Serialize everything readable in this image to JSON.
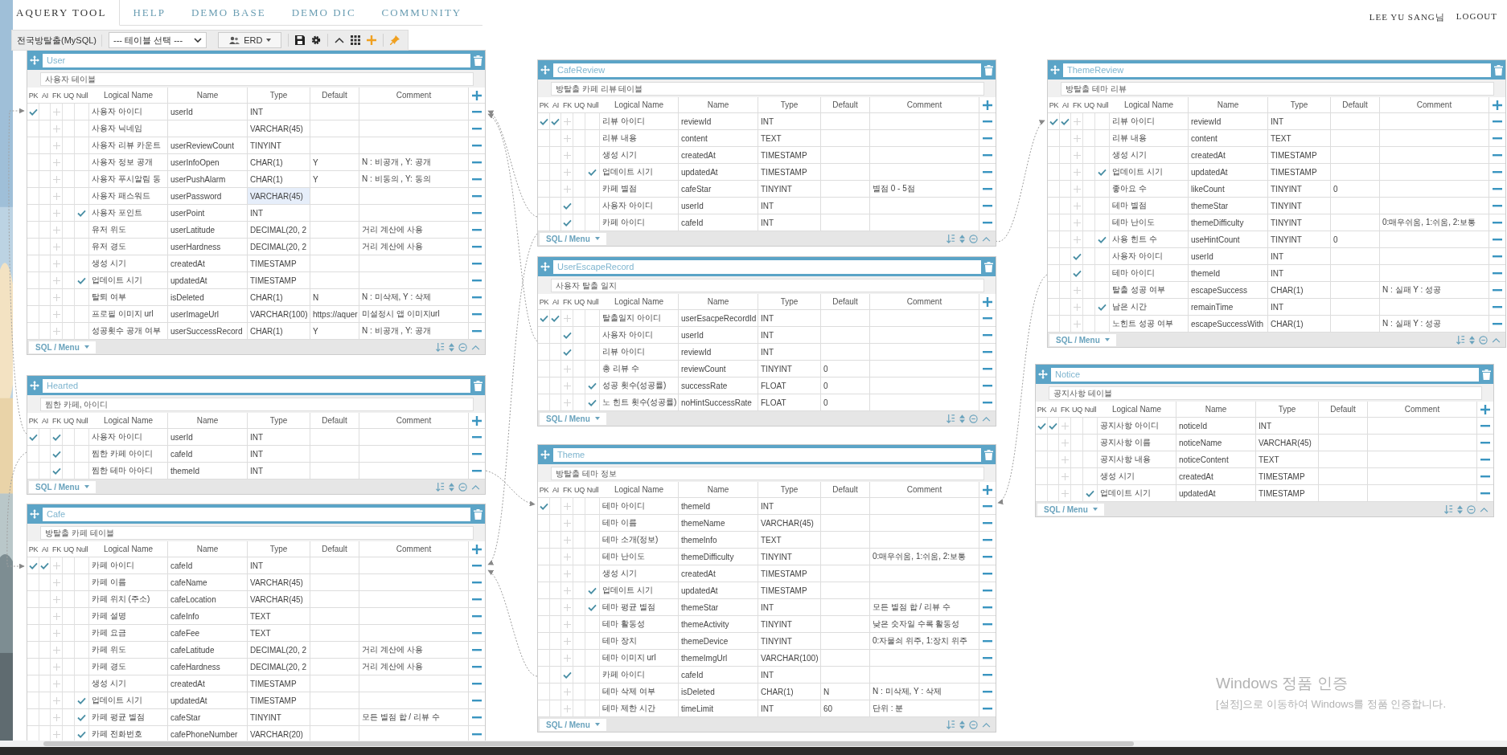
{
  "nav": {
    "tabs": [
      {
        "label": "AQUERY TOOL",
        "selected": true
      },
      {
        "label": "HELP",
        "selected": false
      },
      {
        "label": "DEMO BASE",
        "selected": false
      },
      {
        "label": "DEMO DIC",
        "selected": false
      },
      {
        "label": "COMMUNITY",
        "selected": false
      }
    ],
    "user": "LEE YU SANG님",
    "logout": "LOGOUT"
  },
  "toolbar": {
    "db_label": "전국방탈출(MySQL)",
    "table_select": "--- 테이블 선택 ---",
    "erd_button": "ERD"
  },
  "tables": [
    {
      "name": "User",
      "comment": "사용자 테이블",
      "columns": [
        "PK",
        "AI",
        "FK",
        "UQ",
        "Null",
        "Logical Name",
        "Name",
        "Type",
        "Default",
        "Comment"
      ],
      "menu_label": "SQL / Menu",
      "fields": [
        {
          "pk": true,
          "ai": false,
          "fk": false,
          "nul": false,
          "logical": "사용자 아이디",
          "name": "userId",
          "type": "INT"
        },
        {
          "pk": false,
          "ai": false,
          "fk": false,
          "nul": false,
          "logical": "사용자 닉네임",
          "type": "VARCHAR(45)"
        },
        {
          "pk": false,
          "ai": false,
          "fk": false,
          "nul": false,
          "logical": "사용자 리뷰 카운트",
          "name": "userReviewCount",
          "type": "TINYINT"
        },
        {
          "pk": false,
          "ai": false,
          "fk": false,
          "nul": false,
          "logical": "사용자 정보 공개",
          "name": "userInfoOpen",
          "type": "CHAR(1)",
          "default": "Y",
          "comment": "N : 비공개 , Y: 공개"
        },
        {
          "pk": false,
          "ai": false,
          "fk": false,
          "nul": false,
          "logical": "사용자 푸시알림 동",
          "name": "userPushAlarm",
          "type": "CHAR(1)",
          "default": "Y",
          "comment": "N : 비동의 , Y: 동의"
        },
        {
          "pk": false,
          "ai": false,
          "fk": false,
          "nul": false,
          "logical": "사용자 패스워드",
          "name": "userPassword",
          "type": "VARCHAR(45)",
          "focus": true
        },
        {
          "pk": false,
          "ai": false,
          "fk": false,
          "nul": true,
          "logical": "사용자 포인트",
          "name": "userPoint",
          "type": "INT"
        },
        {
          "pk": false,
          "ai": false,
          "fk": false,
          "nul": false,
          "logical": "유저 위도",
          "name": "userLatitude",
          "type": "DECIMAL(20, 2",
          "comment": "거리 계산에 사용"
        },
        {
          "pk": false,
          "ai": false,
          "fk": false,
          "nul": false,
          "logical": "유저 경도",
          "name": "userHardness",
          "type": "DECIMAL(20, 2",
          "comment": "거리 계산에 사용"
        },
        {
          "pk": false,
          "ai": false,
          "fk": false,
          "nul": false,
          "logical": "생성 시기",
          "name": "createdAt",
          "type": "TIMESTAMP"
        },
        {
          "pk": false,
          "ai": false,
          "fk": false,
          "nul": true,
          "logical": "업데이트 시기",
          "name": "updatedAt",
          "type": "TIMESTAMP"
        },
        {
          "pk": false,
          "ai": false,
          "fk": false,
          "nul": false,
          "logical": "탈퇴 여부",
          "name": "isDeleted",
          "type": "CHAR(1)",
          "default": "N",
          "comment": "N : 미삭제, Y : 삭제"
        },
        {
          "pk": false,
          "ai": false,
          "fk": false,
          "nul": false,
          "logical": "프로필 이미지 url",
          "name": "userImageUrl",
          "type": "VARCHAR(100)",
          "default": "https://aquer",
          "comment": "미설정시 앱 이미지url"
        },
        {
          "pk": false,
          "ai": false,
          "fk": false,
          "nul": false,
          "logical": "성공횟수 공개 여부",
          "name": "userSuccessRecord",
          "type": "CHAR(1)",
          "default": "Y",
          "comment": "N : 비공개 , Y: 공개"
        }
      ]
    },
    {
      "name": "Hearted",
      "comment": "찜한 카페, 아이디",
      "columns": [
        "PK",
        "AI",
        "FK",
        "UQ",
        "Null",
        "Logical Name",
        "Name",
        "Type",
        "Default",
        "Comment"
      ],
      "menu_label": "SQL / Menu",
      "fields": [
        {
          "pk": true,
          "ai": false,
          "fk": true,
          "nul": false,
          "logical": "사용자 아이디",
          "name": "userId",
          "type": "INT"
        },
        {
          "pk": false,
          "ai": false,
          "fk": true,
          "nul": false,
          "logical": "찜한 카페 아이디",
          "name": "cafeId",
          "type": "INT"
        },
        {
          "pk": false,
          "ai": false,
          "fk": true,
          "nul": false,
          "logical": "찜한 테마 아아디",
          "name": "themeId",
          "type": "INT"
        }
      ]
    },
    {
      "name": "Cafe",
      "comment": "방탈출 카페 테이블",
      "columns": [
        "PK",
        "AI",
        "FK",
        "UQ",
        "Null",
        "Logical Name",
        "Name",
        "Type",
        "Default",
        "Comment"
      ],
      "fields": [
        {
          "pk": true,
          "ai": true,
          "fk": false,
          "nul": false,
          "logical": "카페 아이디",
          "name": "cafeId",
          "type": "INT"
        },
        {
          "pk": false,
          "ai": false,
          "fk": false,
          "nul": false,
          "logical": "카페 이름",
          "name": "cafeName",
          "type": "VARCHAR(45)"
        },
        {
          "pk": false,
          "ai": false,
          "fk": false,
          "nul": false,
          "logical": "카페 위치 (주소)",
          "name": "cafeLocation",
          "type": "VARCHAR(45)"
        },
        {
          "pk": false,
          "ai": false,
          "fk": false,
          "nul": false,
          "logical": "카페 설명",
          "name": "cafeInfo",
          "type": "TEXT"
        },
        {
          "pk": false,
          "ai": false,
          "fk": false,
          "nul": false,
          "logical": "카페 요금",
          "name": "cafeFee",
          "type": "TEXT"
        },
        {
          "pk": false,
          "ai": false,
          "fk": false,
          "nul": false,
          "logical": "카페 위도",
          "name": "cafeLatitude",
          "type": "DECIMAL(20, 2",
          "comment": "거리 계산에 사용"
        },
        {
          "pk": false,
          "ai": false,
          "fk": false,
          "nul": false,
          "logical": "카페 경도",
          "name": "cafeHardness",
          "type": "DECIMAL(20, 2",
          "comment": "거리 계산에 사용"
        },
        {
          "pk": false,
          "ai": false,
          "fk": false,
          "nul": false,
          "logical": "생성 시기",
          "name": "createdAt",
          "type": "TIMESTAMP"
        },
        {
          "pk": false,
          "ai": false,
          "fk": false,
          "nul": true,
          "logical": "업데이트 시기",
          "name": "updatedAt",
          "type": "TIMESTAMP"
        },
        {
          "pk": false,
          "ai": false,
          "fk": false,
          "nul": true,
          "logical": "카페 평균 별점",
          "name": "cafeStar",
          "type": "TINYINT",
          "comment": "모든 별점 합 / 리뷰 수"
        },
        {
          "pk": false,
          "ai": false,
          "fk": false,
          "nul": true,
          "logical": "카페 전화번호",
          "name": "cafePhoneNumber",
          "type": "VARCHAR(20)"
        }
      ]
    },
    {
      "name": "CafeReview",
      "comment": "방탈출 카페 리뷰 테이블",
      "columns": [
        "PK",
        "AI",
        "FK",
        "UQ",
        "Null",
        "Logical Name",
        "Name",
        "Type",
        "Default",
        "Comment"
      ],
      "menu_label": "SQL / Menu",
      "fields": [
        {
          "pk": true,
          "ai": true,
          "fk": false,
          "nul": false,
          "logical": "리뷰 아이디",
          "name": "reviewId",
          "type": "INT"
        },
        {
          "pk": false,
          "ai": false,
          "fk": false,
          "nul": false,
          "logical": "리뷰 내용",
          "name": "content",
          "type": "TEXT"
        },
        {
          "pk": false,
          "ai": false,
          "fk": false,
          "nul": false,
          "logical": "생성 시기",
          "name": "createdAt",
          "type": "TIMESTAMP"
        },
        {
          "pk": false,
          "ai": false,
          "fk": false,
          "nul": true,
          "logical": "업데이트 시기",
          "name": "updatedAt",
          "type": "TIMESTAMP"
        },
        {
          "pk": false,
          "ai": false,
          "fk": false,
          "nul": false,
          "logical": "카페 별점",
          "name": "cafeStar",
          "type": "TINYINT",
          "comment": "별점 0 - 5점"
        },
        {
          "pk": false,
          "ai": false,
          "fk": true,
          "nul": false,
          "logical": "사용자 아이디",
          "name": "userId",
          "type": "INT"
        },
        {
          "pk": false,
          "ai": false,
          "fk": true,
          "nul": false,
          "logical": "카페 아이디",
          "name": "cafeId",
          "type": "INT"
        }
      ]
    },
    {
      "name": "UserEscapeRecord",
      "comment": "사용자 탈출 일지",
      "columns": [
        "PK",
        "AI",
        "FK",
        "UQ",
        "Null",
        "Logical Name",
        "Name",
        "Type",
        "Default",
        "Comment"
      ],
      "menu_label": "SQL / Menu",
      "fields": [
        {
          "pk": true,
          "ai": true,
          "fk": false,
          "nul": false,
          "logical": "탈출일지 아이디",
          "name": "userEsacpeRecordId",
          "type": "INT"
        },
        {
          "pk": false,
          "ai": false,
          "fk": true,
          "nul": false,
          "logical": "사용자 아이디",
          "name": "userId",
          "type": "INT"
        },
        {
          "pk": false,
          "ai": false,
          "fk": true,
          "nul": false,
          "logical": "리뷰 아이디",
          "name": "reviewId",
          "type": "INT"
        },
        {
          "pk": false,
          "ai": false,
          "fk": false,
          "nul": false,
          "logical": "총 리뷰 수",
          "name": "reviewCount",
          "type": "TINYINT",
          "default": "0"
        },
        {
          "pk": false,
          "ai": false,
          "fk": false,
          "nul": true,
          "logical": "성공 횟수(성공률)",
          "name": "successRate",
          "type": "FLOAT",
          "default": "0"
        },
        {
          "pk": false,
          "ai": false,
          "fk": false,
          "nul": true,
          "logical": "노 힌트 횟수(성공률)",
          "name": "noHintSuccessRate",
          "type": "FLOAT",
          "default": "0"
        }
      ]
    },
    {
      "name": "Theme",
      "comment": "방탈출 테마 정보",
      "columns": [
        "PK",
        "AI",
        "FK",
        "UQ",
        "Null",
        "Logical Name",
        "Name",
        "Type",
        "Default",
        "Comment"
      ],
      "menu_label": "SQL / Menu",
      "fields": [
        {
          "pk": true,
          "ai": false,
          "fk": false,
          "nul": false,
          "logical": "테마 아이디",
          "name": "themeId",
          "type": "INT"
        },
        {
          "pk": false,
          "ai": false,
          "fk": false,
          "nul": false,
          "logical": "테마 이름",
          "name": "themeName",
          "type": "VARCHAR(45)"
        },
        {
          "pk": false,
          "ai": false,
          "fk": false,
          "nul": false,
          "logical": "테마 소개(정보)",
          "name": "themeInfo",
          "type": "TEXT"
        },
        {
          "pk": false,
          "ai": false,
          "fk": false,
          "nul": false,
          "logical": "테마 난이도",
          "name": "themeDifficulty",
          "type": "TINYINT",
          "comment": "0:매우쉬움, 1:쉬움, 2:보통"
        },
        {
          "pk": false,
          "ai": false,
          "fk": false,
          "nul": false,
          "logical": "생성 시기",
          "name": "createdAt",
          "type": "TIMESTAMP"
        },
        {
          "pk": false,
          "ai": false,
          "fk": false,
          "nul": true,
          "logical": "업데이트 시기",
          "name": "updatedAt",
          "type": "TIMESTAMP"
        },
        {
          "pk": false,
          "ai": false,
          "fk": false,
          "nul": true,
          "logical": "테마 평균 별점",
          "name": "themeStar",
          "type": "INT",
          "comment": "모든 별점 합 / 리뷰 수"
        },
        {
          "pk": false,
          "ai": false,
          "fk": false,
          "nul": false,
          "logical": "테마 활동성",
          "name": "themeActivity",
          "type": "TINYINT",
          "comment": "낮은 숫자일 수록 활동성"
        },
        {
          "pk": false,
          "ai": false,
          "fk": false,
          "nul": false,
          "logical": "테마 장치",
          "name": "themeDevice",
          "type": "TINYINT",
          "comment": "0:자물쇠 위주, 1:장치 위주"
        },
        {
          "pk": false,
          "ai": false,
          "fk": false,
          "nul": false,
          "logical": "테마 이미지 url",
          "name": "themeImgUrl",
          "type": "VARCHAR(100)"
        },
        {
          "pk": false,
          "ai": false,
          "fk": true,
          "nul": false,
          "logical": "카페 아이디",
          "name": "cafeId",
          "type": "INT"
        },
        {
          "pk": false,
          "ai": false,
          "fk": false,
          "nul": false,
          "logical": "테마 삭제 여부",
          "name": "isDeleted",
          "type": "CHAR(1)",
          "default": "N",
          "comment": "N : 미삭제, Y : 삭제"
        },
        {
          "pk": false,
          "ai": false,
          "fk": false,
          "nul": false,
          "logical": "테마 제한 시간",
          "name": "timeLimit",
          "type": "INT",
          "default": "60",
          "comment": "단위 : 분"
        }
      ]
    },
    {
      "name": "ThemeReview",
      "comment": "방탈출 테마 리뷰",
      "columns": [
        "PK",
        "AI",
        "FK",
        "UQ",
        "Null",
        "Logical Name",
        "Name",
        "Type",
        "Default",
        "Comment"
      ],
      "menu_label": "SQL / Menu",
      "fields": [
        {
          "pk": true,
          "ai": true,
          "fk": false,
          "nul": false,
          "logical": "리뷰 아이디",
          "name": "reviewId",
          "type": "INT"
        },
        {
          "pk": false,
          "ai": false,
          "fk": false,
          "nul": false,
          "logical": "리뷰 내용",
          "name": "content",
          "type": "TEXT"
        },
        {
          "pk": false,
          "ai": false,
          "fk": false,
          "nul": false,
          "logical": "생성 시기",
          "name": "createdAt",
          "type": "TIMESTAMP"
        },
        {
          "pk": false,
          "ai": false,
          "fk": false,
          "nul": true,
          "logical": "업데이트 시기",
          "name": "updatedAt",
          "type": "TIMESTAMP"
        },
        {
          "pk": false,
          "ai": false,
          "fk": false,
          "nul": false,
          "logical": "좋아요 수",
          "name": "likeCount",
          "type": "TINYINT",
          "default": "0"
        },
        {
          "pk": false,
          "ai": false,
          "fk": false,
          "nul": false,
          "logical": "테마 별점",
          "name": "themeStar",
          "type": "TINYINT"
        },
        {
          "pk": false,
          "ai": false,
          "fk": false,
          "nul": false,
          "logical": "테마 난이도",
          "name": "themeDifficulty",
          "type": "TINYINT",
          "comment": "0:매우쉬움, 1:쉬움, 2:보통"
        },
        {
          "pk": false,
          "ai": false,
          "fk": false,
          "nul": true,
          "logical": "사용 힌트 수",
          "name": "useHintCount",
          "type": "TINYINT",
          "default": "0"
        },
        {
          "pk": false,
          "ai": false,
          "fk": true,
          "nul": false,
          "logical": "사용자 아이디",
          "name": "userId",
          "type": "INT"
        },
        {
          "pk": false,
          "ai": false,
          "fk": true,
          "nul": false,
          "logical": "테마 아이디",
          "name": "themeId",
          "type": "INT"
        },
        {
          "pk": false,
          "ai": false,
          "fk": false,
          "nul": false,
          "logical": "탈출 성공 여부",
          "name": "escapeSuccess",
          "type": "CHAR(1)",
          "comment": "N : 실패 Y : 성공"
        },
        {
          "pk": false,
          "ai": false,
          "fk": false,
          "nul": true,
          "logical": "남은 시간",
          "name": "remainTime",
          "type": "INT"
        },
        {
          "pk": false,
          "ai": false,
          "fk": false,
          "nul": false,
          "logical": "노힌트 성공 여부",
          "name": "escapeSuccessWith",
          "type": "CHAR(1)",
          "comment": "N : 실패 Y : 성공"
        }
      ]
    },
    {
      "name": "Notice",
      "comment": "공지사항 테이블",
      "columns": [
        "PK",
        "AI",
        "FK",
        "UQ",
        "Null",
        "Logical Name",
        "Name",
        "Type",
        "Default",
        "Comment"
      ],
      "menu_label": "SQL / Menu",
      "fields": [
        {
          "pk": true,
          "ai": true,
          "fk": false,
          "nul": false,
          "logical": "공지사항 아이디",
          "name": "noticeId",
          "type": "INT"
        },
        {
          "pk": false,
          "ai": false,
          "fk": false,
          "nul": false,
          "logical": "공지사항 이름",
          "name": "noticeName",
          "type": "VARCHAR(45)"
        },
        {
          "pk": false,
          "ai": false,
          "fk": false,
          "nul": false,
          "logical": "공지사항 내용",
          "name": "noticeContent",
          "type": "TEXT"
        },
        {
          "pk": false,
          "ai": false,
          "fk": false,
          "nul": false,
          "logical": "생성 시기",
          "name": "createdAt",
          "type": "TIMESTAMP"
        },
        {
          "pk": false,
          "ai": false,
          "fk": false,
          "nul": true,
          "logical": "업데이트 시기",
          "name": "updatedAt",
          "type": "TIMESTAMP"
        }
      ]
    }
  ],
  "os_activation_notice": {
    "title": "Windows 정품 인증",
    "text": "[설정]으로 이동하여 Windows를 정품 인증합니다."
  }
}
